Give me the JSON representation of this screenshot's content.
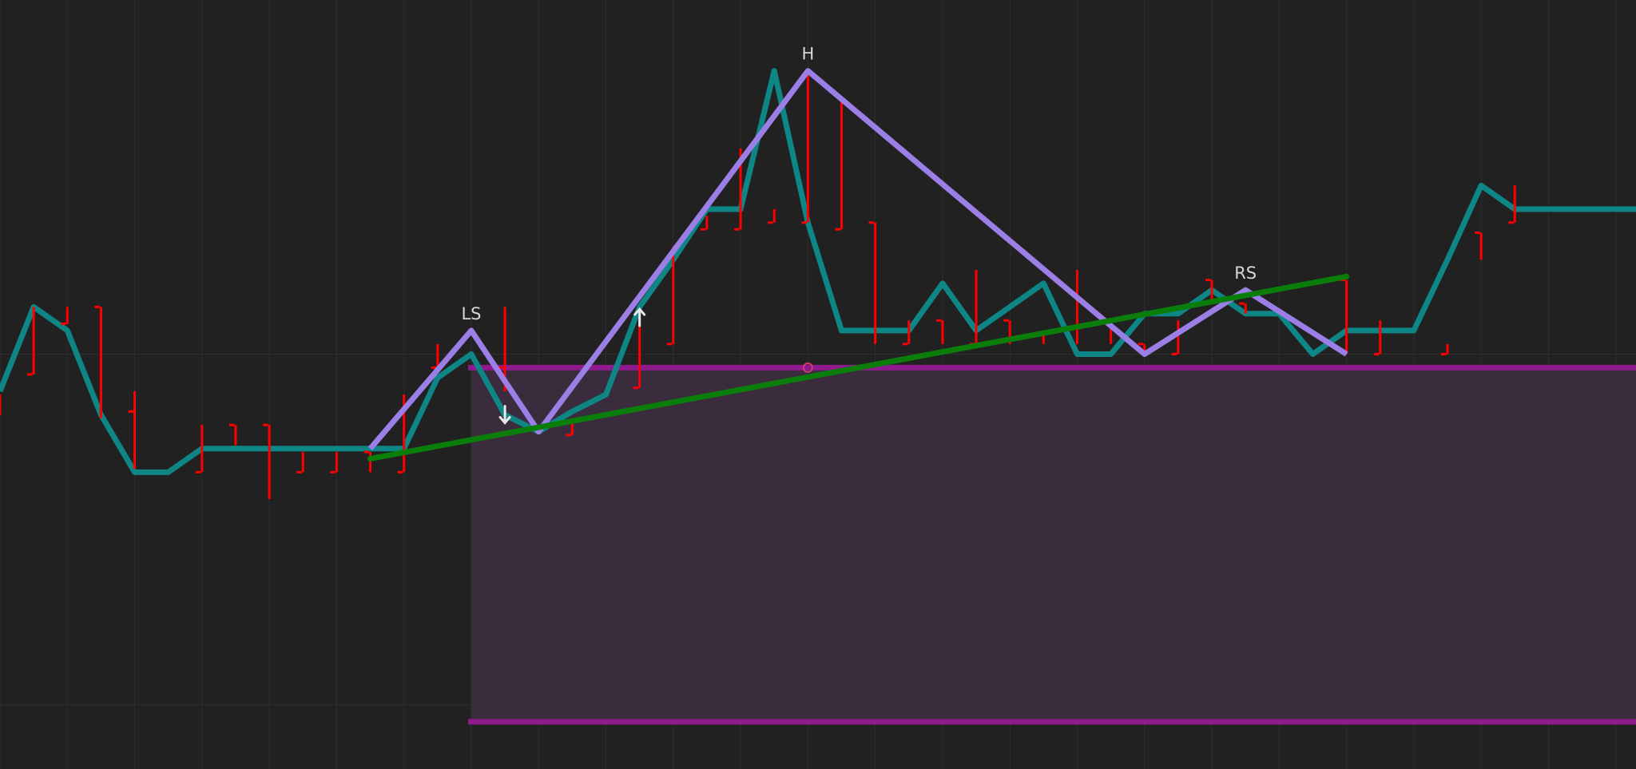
{
  "colors": {
    "background": "#212121",
    "grid": "#2e2e2e",
    "price": "#0e8686",
    "bars": "#ff0000",
    "pattern": "#9b7fe6",
    "neckline": "#0b7d0b",
    "target_zone_fill": "#3a2b3d",
    "target_zone_edge": "#8e1a8e",
    "marker_arrow": "#e8e8e8",
    "marker_circle": "#d33a6f"
  },
  "chart_data": {
    "type": "line",
    "title": "",
    "xlabel": "",
    "ylabel": "",
    "x_start": 0,
    "x_step": 1,
    "xlim": [
      0,
      48.6
    ],
    "ylim": [
      -8.6,
      14.2
    ],
    "grid": true,
    "series": [
      {
        "values": [
          2.6,
          5.1,
          4.4,
          1.9,
          0.2,
          0.2,
          0.9,
          0.9,
          0.9,
          0.9,
          0.9,
          0.9,
          0.9,
          3.0,
          3.7,
          1.9,
          1.4,
          2.0,
          2.5,
          5.1,
          6.5,
          8.0,
          8.0,
          12.1,
          7.6,
          4.4,
          4.4,
          4.4,
          5.8,
          4.4,
          5.1,
          5.8,
          3.7,
          3.7,
          4.9,
          4.9,
          5.6,
          4.9,
          4.9,
          3.7,
          4.4,
          4.4,
          4.4,
          6.5,
          8.7,
          8.0,
          8.0,
          8.0,
          8.0,
          8.0
        ]
      }
    ],
    "bars": [
      {
        "x": 0,
        "high": 2.5,
        "low": 1.9,
        "close": 2.0
      },
      {
        "x": 1,
        "high": 5.1,
        "low": 3.1,
        "close": 3.1
      },
      {
        "x": 2,
        "high": 5.1,
        "low": 4.6,
        "close": 4.6
      },
      {
        "x": 3,
        "high": 5.1,
        "low": 1.8,
        "close": 5.1
      },
      {
        "x": 4,
        "high": 2.6,
        "low": 0.3,
        "close": 2.0
      },
      {
        "x": 6,
        "high": 1.6,
        "low": 0.2,
        "close": 0.2
      },
      {
        "x": 7,
        "high": 1.6,
        "low": 1.0,
        "close": 1.6
      },
      {
        "x": 8,
        "high": 1.6,
        "low": -0.6,
        "close": 1.6
      },
      {
        "x": 9,
        "high": 0.8,
        "low": 0.2,
        "close": 0.2
      },
      {
        "x": 10,
        "high": 0.8,
        "low": 0.2,
        "close": 0.2
      },
      {
        "x": 11,
        "high": 0.8,
        "low": 0.2,
        "close": 0.8
      },
      {
        "x": 12,
        "high": 2.5,
        "low": 0.2,
        "close": 0.2
      },
      {
        "x": 13,
        "high": 4.0,
        "low": 3.3,
        "close": 3.3
      },
      {
        "x": 15,
        "high": 5.1,
        "low": 2.6,
        "close": 3.3
      },
      {
        "x": 17,
        "high": 1.8,
        "low": 1.3,
        "close": 1.3
      },
      {
        "x": 19,
        "high": 4.8,
        "low": 2.7,
        "close": 2.7
      },
      {
        "x": 20,
        "high": 6.9,
        "low": 4.0,
        "close": 4.0
      },
      {
        "x": 21,
        "high": 7.8,
        "low": 7.4,
        "close": 7.4
      },
      {
        "x": 22,
        "high": 9.8,
        "low": 7.4,
        "close": 7.4
      },
      {
        "x": 23,
        "high": 8.0,
        "low": 7.6,
        "close": 7.6
      },
      {
        "x": 24,
        "high": 12.0,
        "low": 7.6,
        "close": 7.6
      },
      {
        "x": 25,
        "high": 11.3,
        "low": 7.4,
        "close": 7.4
      },
      {
        "x": 26,
        "high": 7.6,
        "low": 4.0,
        "close": 7.6
      },
      {
        "x": 27,
        "high": 4.7,
        "low": 4.0,
        "close": 4.0
      },
      {
        "x": 28,
        "high": 4.7,
        "low": 4.0,
        "close": 4.7
      },
      {
        "x": 29,
        "high": 6.2,
        "low": 4.0,
        "close": 4.0
      },
      {
        "x": 30,
        "high": 4.7,
        "low": 4.0,
        "close": 4.7
      },
      {
        "x": 31,
        "high": 4.3,
        "low": 4.0,
        "close": 4.3
      },
      {
        "x": 32,
        "high": 6.2,
        "low": 4.0,
        "close": 5.5
      },
      {
        "x": 33,
        "high": 4.7,
        "low": 4.0,
        "close": 4.7
      },
      {
        "x": 34,
        "high": 4.0,
        "low": 3.7,
        "close": 4.0
      },
      {
        "x": 35,
        "high": 4.7,
        "low": 3.7,
        "close": 3.7
      },
      {
        "x": 36,
        "high": 5.9,
        "low": 5.2,
        "close": 5.9
      },
      {
        "x": 37,
        "high": 5.2,
        "low": 4.9,
        "close": 5.2
      },
      {
        "x": 40,
        "high": 5.9,
        "low": 3.7,
        "close": 5.9
      },
      {
        "x": 41,
        "high": 4.7,
        "low": 3.7,
        "close": 3.7
      },
      {
        "x": 43,
        "high": 4.0,
        "low": 3.7,
        "close": 3.7
      },
      {
        "x": 44,
        "high": 7.3,
        "low": 6.5,
        "close": 7.3
      },
      {
        "x": 45,
        "high": 8.7,
        "low": 7.6,
        "close": 7.6
      }
    ],
    "pattern": {
      "points": [
        {
          "x": 11,
          "y": 0.9,
          "label": ""
        },
        {
          "x": 14,
          "y": 4.4,
          "label": "LS"
        },
        {
          "x": 16,
          "y": 1.4,
          "label": ""
        },
        {
          "x": 24,
          "y": 12.1,
          "label": "H"
        },
        {
          "x": 34,
          "y": 3.7,
          "label": ""
        },
        {
          "x": 37,
          "y": 5.6,
          "label": "RS"
        },
        {
          "x": 40,
          "y": 3.7,
          "label": ""
        }
      ]
    },
    "neckline": {
      "x": [
        11,
        40
      ],
      "y": [
        0.6,
        6.0
      ]
    },
    "target_zone": {
      "x_start": 14,
      "y_top": 3.3,
      "y_bottom": -7.2
    },
    "markers": [
      {
        "type": "arrow-up",
        "x": 15,
        "y": 1.9
      },
      {
        "type": "arrow-down",
        "x": 19,
        "y": 4.8
      },
      {
        "type": "circle",
        "x": 24,
        "y": 3.3
      }
    ]
  }
}
